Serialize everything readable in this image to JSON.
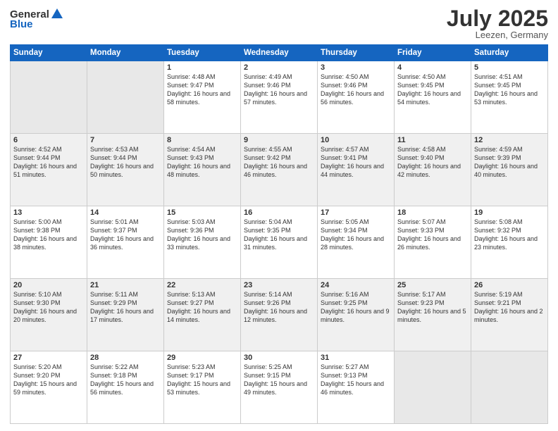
{
  "header": {
    "logo_general": "General",
    "logo_blue": "Blue",
    "title": "July 2025",
    "location": "Leezen, Germany"
  },
  "weekdays": [
    "Sunday",
    "Monday",
    "Tuesday",
    "Wednesday",
    "Thursday",
    "Friday",
    "Saturday"
  ],
  "weeks": [
    [
      {
        "day": "",
        "sunrise": "",
        "sunset": "",
        "daylight": ""
      },
      {
        "day": "",
        "sunrise": "",
        "sunset": "",
        "daylight": ""
      },
      {
        "day": "1",
        "sunrise": "Sunrise: 4:48 AM",
        "sunset": "Sunset: 9:47 PM",
        "daylight": "Daylight: 16 hours and 58 minutes."
      },
      {
        "day": "2",
        "sunrise": "Sunrise: 4:49 AM",
        "sunset": "Sunset: 9:46 PM",
        "daylight": "Daylight: 16 hours and 57 minutes."
      },
      {
        "day": "3",
        "sunrise": "Sunrise: 4:50 AM",
        "sunset": "Sunset: 9:46 PM",
        "daylight": "Daylight: 16 hours and 56 minutes."
      },
      {
        "day": "4",
        "sunrise": "Sunrise: 4:50 AM",
        "sunset": "Sunset: 9:45 PM",
        "daylight": "Daylight: 16 hours and 54 minutes."
      },
      {
        "day": "5",
        "sunrise": "Sunrise: 4:51 AM",
        "sunset": "Sunset: 9:45 PM",
        "daylight": "Daylight: 16 hours and 53 minutes."
      }
    ],
    [
      {
        "day": "6",
        "sunrise": "Sunrise: 4:52 AM",
        "sunset": "Sunset: 9:44 PM",
        "daylight": "Daylight: 16 hours and 51 minutes."
      },
      {
        "day": "7",
        "sunrise": "Sunrise: 4:53 AM",
        "sunset": "Sunset: 9:44 PM",
        "daylight": "Daylight: 16 hours and 50 minutes."
      },
      {
        "day": "8",
        "sunrise": "Sunrise: 4:54 AM",
        "sunset": "Sunset: 9:43 PM",
        "daylight": "Daylight: 16 hours and 48 minutes."
      },
      {
        "day": "9",
        "sunrise": "Sunrise: 4:55 AM",
        "sunset": "Sunset: 9:42 PM",
        "daylight": "Daylight: 16 hours and 46 minutes."
      },
      {
        "day": "10",
        "sunrise": "Sunrise: 4:57 AM",
        "sunset": "Sunset: 9:41 PM",
        "daylight": "Daylight: 16 hours and 44 minutes."
      },
      {
        "day": "11",
        "sunrise": "Sunrise: 4:58 AM",
        "sunset": "Sunset: 9:40 PM",
        "daylight": "Daylight: 16 hours and 42 minutes."
      },
      {
        "day": "12",
        "sunrise": "Sunrise: 4:59 AM",
        "sunset": "Sunset: 9:39 PM",
        "daylight": "Daylight: 16 hours and 40 minutes."
      }
    ],
    [
      {
        "day": "13",
        "sunrise": "Sunrise: 5:00 AM",
        "sunset": "Sunset: 9:38 PM",
        "daylight": "Daylight: 16 hours and 38 minutes."
      },
      {
        "day": "14",
        "sunrise": "Sunrise: 5:01 AM",
        "sunset": "Sunset: 9:37 PM",
        "daylight": "Daylight: 16 hours and 36 minutes."
      },
      {
        "day": "15",
        "sunrise": "Sunrise: 5:03 AM",
        "sunset": "Sunset: 9:36 PM",
        "daylight": "Daylight: 16 hours and 33 minutes."
      },
      {
        "day": "16",
        "sunrise": "Sunrise: 5:04 AM",
        "sunset": "Sunset: 9:35 PM",
        "daylight": "Daylight: 16 hours and 31 minutes."
      },
      {
        "day": "17",
        "sunrise": "Sunrise: 5:05 AM",
        "sunset": "Sunset: 9:34 PM",
        "daylight": "Daylight: 16 hours and 28 minutes."
      },
      {
        "day": "18",
        "sunrise": "Sunrise: 5:07 AM",
        "sunset": "Sunset: 9:33 PM",
        "daylight": "Daylight: 16 hours and 26 minutes."
      },
      {
        "day": "19",
        "sunrise": "Sunrise: 5:08 AM",
        "sunset": "Sunset: 9:32 PM",
        "daylight": "Daylight: 16 hours and 23 minutes."
      }
    ],
    [
      {
        "day": "20",
        "sunrise": "Sunrise: 5:10 AM",
        "sunset": "Sunset: 9:30 PM",
        "daylight": "Daylight: 16 hours and 20 minutes."
      },
      {
        "day": "21",
        "sunrise": "Sunrise: 5:11 AM",
        "sunset": "Sunset: 9:29 PM",
        "daylight": "Daylight: 16 hours and 17 minutes."
      },
      {
        "day": "22",
        "sunrise": "Sunrise: 5:13 AM",
        "sunset": "Sunset: 9:27 PM",
        "daylight": "Daylight: 16 hours and 14 minutes."
      },
      {
        "day": "23",
        "sunrise": "Sunrise: 5:14 AM",
        "sunset": "Sunset: 9:26 PM",
        "daylight": "Daylight: 16 hours and 12 minutes."
      },
      {
        "day": "24",
        "sunrise": "Sunrise: 5:16 AM",
        "sunset": "Sunset: 9:25 PM",
        "daylight": "Daylight: 16 hours and 9 minutes."
      },
      {
        "day": "25",
        "sunrise": "Sunrise: 5:17 AM",
        "sunset": "Sunset: 9:23 PM",
        "daylight": "Daylight: 16 hours and 5 minutes."
      },
      {
        "day": "26",
        "sunrise": "Sunrise: 5:19 AM",
        "sunset": "Sunset: 9:21 PM",
        "daylight": "Daylight: 16 hours and 2 minutes."
      }
    ],
    [
      {
        "day": "27",
        "sunrise": "Sunrise: 5:20 AM",
        "sunset": "Sunset: 9:20 PM",
        "daylight": "Daylight: 15 hours and 59 minutes."
      },
      {
        "day": "28",
        "sunrise": "Sunrise: 5:22 AM",
        "sunset": "Sunset: 9:18 PM",
        "daylight": "Daylight: 15 hours and 56 minutes."
      },
      {
        "day": "29",
        "sunrise": "Sunrise: 5:23 AM",
        "sunset": "Sunset: 9:17 PM",
        "daylight": "Daylight: 15 hours and 53 minutes."
      },
      {
        "day": "30",
        "sunrise": "Sunrise: 5:25 AM",
        "sunset": "Sunset: 9:15 PM",
        "daylight": "Daylight: 15 hours and 49 minutes."
      },
      {
        "day": "31",
        "sunrise": "Sunrise: 5:27 AM",
        "sunset": "Sunset: 9:13 PM",
        "daylight": "Daylight: 15 hours and 46 minutes."
      },
      {
        "day": "",
        "sunrise": "",
        "sunset": "",
        "daylight": ""
      },
      {
        "day": "",
        "sunrise": "",
        "sunset": "",
        "daylight": ""
      }
    ]
  ]
}
